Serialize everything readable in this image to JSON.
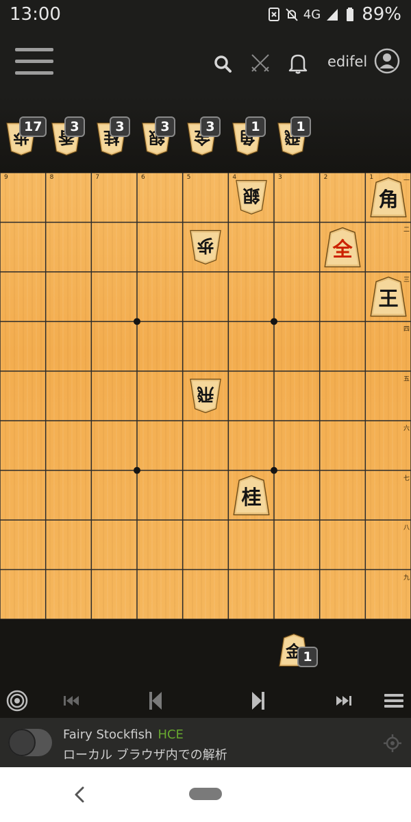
{
  "status_bar": {
    "time": "13:00",
    "network": "4G",
    "battery": "89%"
  },
  "header": {
    "username": "edifel"
  },
  "board": {
    "file_labels": [
      "9",
      "8",
      "7",
      "6",
      "5",
      "4",
      "3",
      "2",
      "1"
    ],
    "rank_labels": [
      "一",
      "二",
      "三",
      "四",
      "五",
      "六",
      "七",
      "八",
      "九"
    ],
    "pieces": [
      {
        "id": "b-silver-4-1",
        "char": "銀",
        "file": 4,
        "rank": 1,
        "owner": "gote",
        "promoted": false
      },
      {
        "id": "s-bishop-1-1",
        "char": "角",
        "file": 1,
        "rank": 1,
        "owner": "sente",
        "promoted": false
      },
      {
        "id": "b-pawn-5-2",
        "char": "歩",
        "file": 5,
        "rank": 2,
        "owner": "gote",
        "promoted": false
      },
      {
        "id": "s-prosilver-2-2",
        "char": "全",
        "file": 2,
        "rank": 2,
        "owner": "sente",
        "promoted": true
      },
      {
        "id": "s-king-1-3",
        "char": "王",
        "file": 1,
        "rank": 3,
        "owner": "sente",
        "promoted": false
      },
      {
        "id": "b-rook-5-5",
        "char": "飛",
        "file": 5,
        "rank": 5,
        "owner": "gote",
        "promoted": false
      },
      {
        "id": "s-knight-4-7",
        "char": "桂",
        "file": 4,
        "rank": 7,
        "owner": "sente",
        "promoted": false
      }
    ]
  },
  "hand_top": [
    {
      "char": "歩",
      "count": "17"
    },
    {
      "char": "香",
      "count": "3"
    },
    {
      "char": "桂",
      "count": "3"
    },
    {
      "char": "銀",
      "count": "3"
    },
    {
      "char": "金",
      "count": "3"
    },
    {
      "char": "角",
      "count": "1"
    },
    {
      "char": "飛",
      "count": "1"
    }
  ],
  "hand_bottom": [
    {
      "char": "金",
      "count": "1"
    }
  ],
  "analysis": {
    "engine_name": "Fairy Stockfish",
    "engine_tag": "HCE",
    "description": "ローカル ブラウザ内での解析"
  },
  "colors": {
    "background": "#161512",
    "board": "#f3ad4f",
    "grid_line": "#2a2a2a",
    "engine_tag": "#68a82f",
    "promoted_text": "#cc2200"
  },
  "icons": [
    "hamburger-icon",
    "search-icon",
    "swords-icon",
    "bell-icon",
    "avatar-icon",
    "analysis-target-icon",
    "first-move-icon",
    "prev-move-icon",
    "next-move-icon",
    "last-move-icon",
    "menu-icon",
    "crosshair-icon",
    "back-icon",
    "home-pill"
  ]
}
